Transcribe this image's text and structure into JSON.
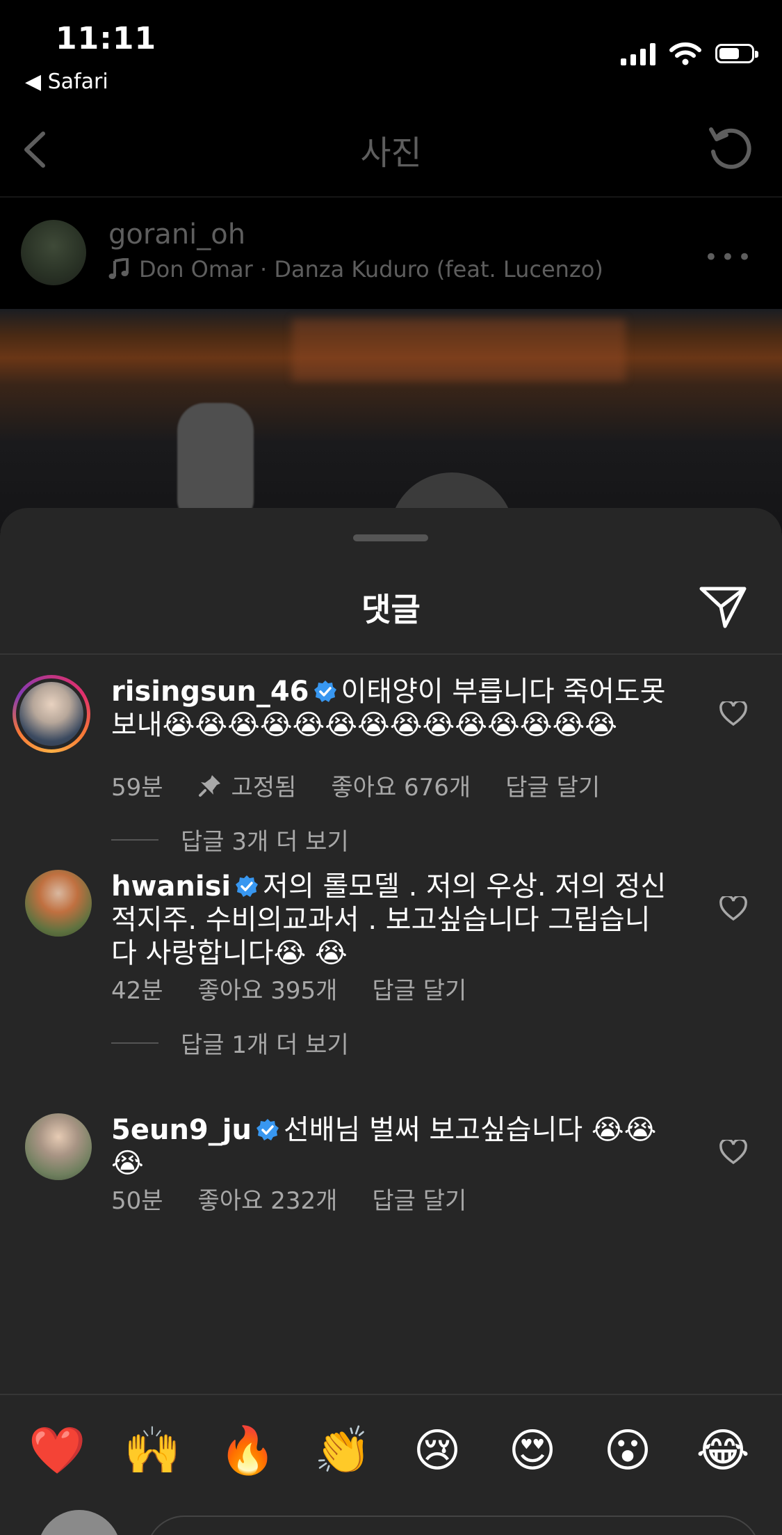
{
  "status": {
    "time": "11:11",
    "back_app": "Safari"
  },
  "nav": {
    "title": "사진"
  },
  "post": {
    "username": "gorani_oh",
    "music": "Don Omar · Danza Kuduro (feat. Lucenzo)"
  },
  "sheet": {
    "title": "댓글"
  },
  "comments": [
    {
      "username": "risingsun_46",
      "text": "이태양이 부릅니다 죽어도못보내😭😭😭😭😭😭😭😭😭😭😭😭😭😭",
      "time": "59분",
      "pinned": "고정됨",
      "likes": "좋아요 676개",
      "reply": "답글 달기",
      "more_replies": "답글 3개 더 보기"
    },
    {
      "username": "hwanisi",
      "text": "저의 롤모델 . 저의 우상. 저의 정신적지주. 수비의교과서 . 보고싶습니다 그립습니다 사랑합니다😭 😭",
      "time": "42분",
      "likes": "좋아요 395개",
      "reply": "답글 달기",
      "more_replies": "답글 1개 더 보기"
    },
    {
      "username": "5eun9_ju",
      "text": "선배님 벌써 보고싶습니다 😭😭 😭",
      "time": "50분",
      "likes": "좋아요 232개",
      "reply": "답글 달기"
    }
  ],
  "emoji_bar": [
    "❤️",
    "🙌",
    "🔥",
    "👏",
    "😢",
    "😍",
    "😮",
    "😂"
  ],
  "colors": {
    "sheet_bg": "#262626",
    "verified": "#3897f0",
    "meta_text": "#a8a8a8"
  }
}
